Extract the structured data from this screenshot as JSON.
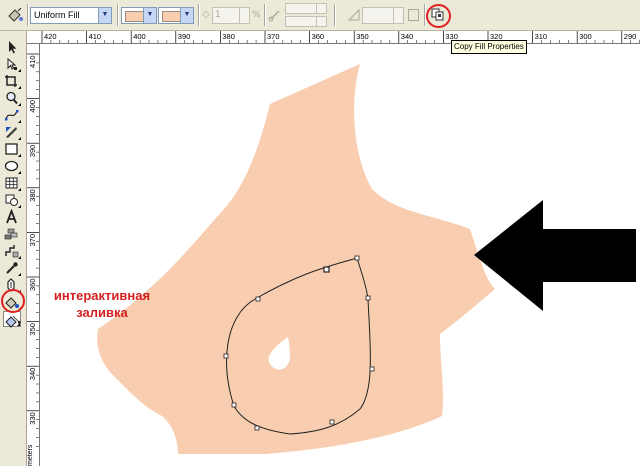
{
  "property_bar": {
    "fill_type": "Uniform Fill",
    "angle_value": "1",
    "angle_unit": "%",
    "colors": {
      "start": "#f9cdb0",
      "end": "#f9cdb0"
    }
  },
  "tooltip": "Copy Fill Properties",
  "rulers": {
    "horizontal_labels": [
      "420",
      "410",
      "400",
      "390",
      "380",
      "370",
      "360",
      "350",
      "340",
      "330",
      "320",
      "310",
      "300",
      "290"
    ],
    "vertical_labels": [
      "410",
      "400",
      "390",
      "380",
      "370",
      "360",
      "350",
      "340",
      "330"
    ],
    "unit": "meters"
  },
  "toolbox": {
    "tools": [
      "pick-tool",
      "shape-tool",
      "crop-tool",
      "zoom-tool",
      "freehand-tool",
      "smart-fill-tool",
      "rectangle-tool",
      "ellipse-tool",
      "polygon-tool",
      "basic-shapes-tool",
      "text-tool",
      "table-tool",
      "dimension-tool",
      "eyedropper-tool",
      "outline-tool",
      "fill-tool",
      "interactive-fill-tool"
    ]
  },
  "canvas": {
    "caption_line1": "интерактивная",
    "caption_line2": "заливка",
    "shape_fill": "#f9cdb0",
    "arrow_color": "#000000",
    "highlight_color": "#e02020"
  }
}
